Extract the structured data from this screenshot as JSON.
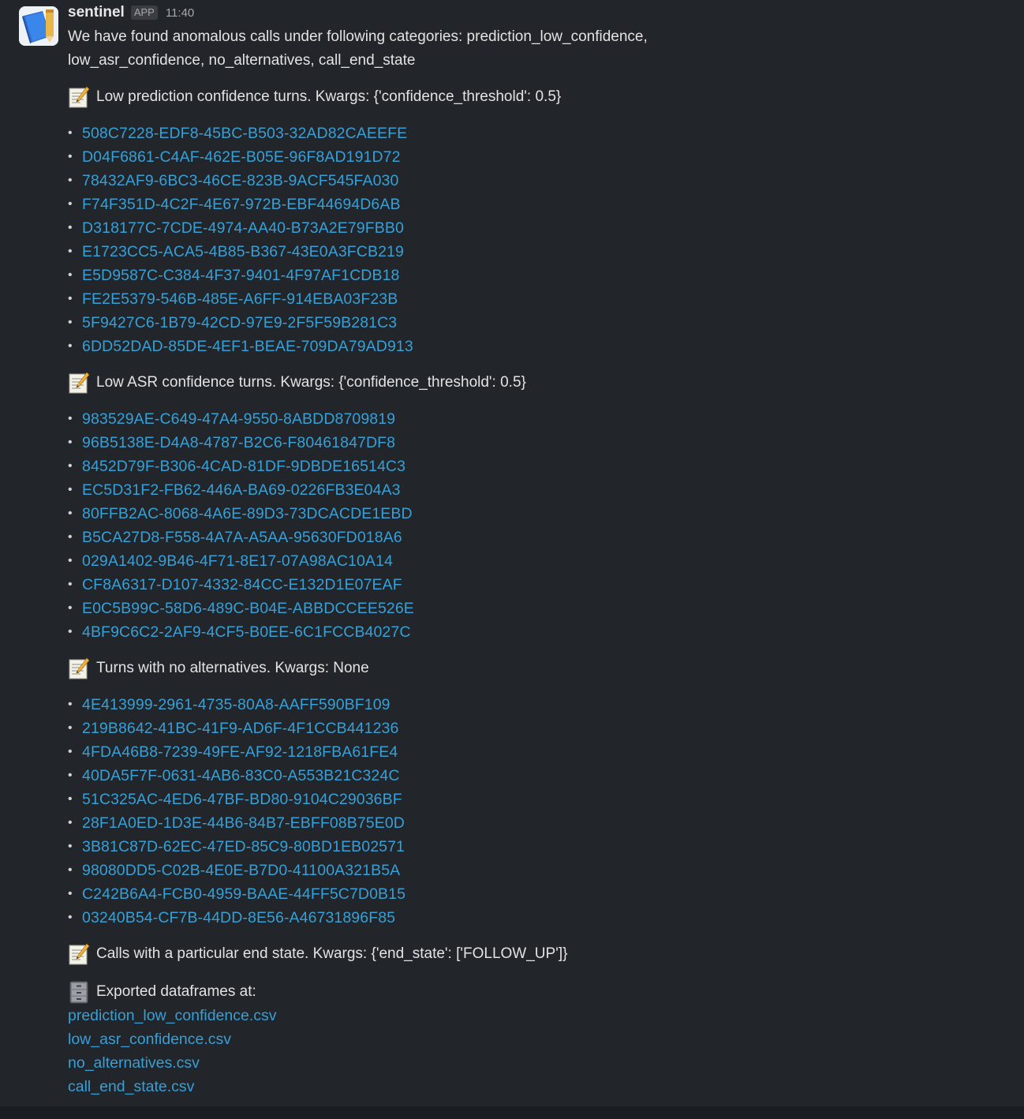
{
  "message": {
    "sender": "sentinel",
    "badge": "APP",
    "time": "11:40",
    "intro": "We have found anomalous calls under following categories: prediction_low_confidence, low_asr_confidence, no_alternatives, call_end_state"
  },
  "sections": [
    {
      "icon": "memo-icon",
      "title": "Low prediction confidence turns. Kwargs: {'confidence_threshold': 0.5}",
      "ids": [
        "508C7228-EDF8-45BC-B503-32AD82CAEEFE",
        "D04F6861-C4AF-462E-B05E-96F8AD191D72",
        "78432AF9-6BC3-46CE-823B-9ACF545FA030",
        "F74F351D-4C2F-4E67-972B-EBF44694D6AB",
        "D318177C-7CDE-4974-AA40-B73A2E79FBB0",
        "E1723CC5-ACA5-4B85-B367-43E0A3FCB219",
        "E5D9587C-C384-4F37-9401-4F97AF1CDB18",
        "FE2E5379-546B-485E-A6FF-914EBA03F23B",
        "5F9427C6-1B79-42CD-97E9-2F5F59B281C3",
        "6DD52DAD-85DE-4EF1-BEAE-709DA79AD913"
      ]
    },
    {
      "icon": "memo-icon",
      "title": "Low ASR confidence turns. Kwargs: {'confidence_threshold': 0.5}",
      "ids": [
        "983529AE-C649-47A4-9550-8ABDD8709819",
        "96B5138E-D4A8-4787-B2C6-F80461847DF8",
        "8452D79F-B306-4CAD-81DF-9DBDE16514C3",
        "EC5D31F2-FB62-446A-BA69-0226FB3E04A3",
        "80FFB2AC-8068-4A6E-89D3-73DCACDE1EBD",
        "B5CA27D8-F558-4A7A-A5AA-95630FD018A6",
        "029A1402-9B46-4F71-8E17-07A98AC10A14",
        "CF8A6317-D107-4332-84CC-E132D1E07EAF",
        "E0C5B99C-58D6-489C-B04E-ABBDCCEE526E",
        "4BF9C6C2-2AF9-4CF5-B0EE-6C1FCCB4027C"
      ]
    },
    {
      "icon": "memo-icon",
      "title": "Turns with no alternatives. Kwargs: None",
      "ids": [
        "4E413999-2961-4735-80A8-AAFF590BF109",
        "219B8642-41BC-41F9-AD6F-4F1CCB441236",
        "4FDA46B8-7239-49FE-AF92-1218FBA61FE4",
        "40DA5F7F-0631-4AB6-83C0-A553B21C324C",
        "51C325AC-4ED6-47BF-BD80-9104C29036BF",
        "28F1A0ED-1D3E-44B6-84B7-EBFF08B75E0D",
        "3B81C87D-62EC-47ED-85C9-80BD1EB02571",
        "98080DD5-C02B-4E0E-B7D0-41100A321B5A",
        "C242B6A4-FCB0-4959-BAAE-44FF5C7D0B15",
        "03240B54-CF7B-44DD-8E56-A46731896F85"
      ]
    },
    {
      "icon": "memo-icon",
      "title": "Calls with a particular end state. Kwargs: {'end_state': ['FOLLOW_UP']}",
      "ids": []
    }
  ],
  "export": {
    "icon": "file-cabinet-icon",
    "title": "Exported dataframes at:",
    "files": [
      "prediction_low_confidence.csv",
      "low_asr_confidence.csv",
      "no_alternatives.csv",
      "call_end_state.csv"
    ]
  },
  "colors": {
    "background": "#222529",
    "link": "#36a0d8",
    "text": "#e3e3e3"
  }
}
